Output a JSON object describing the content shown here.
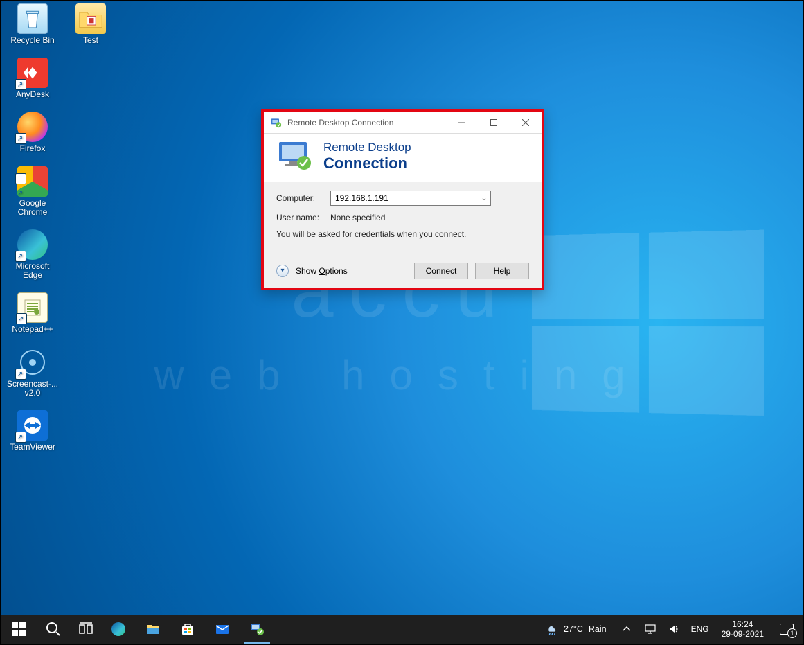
{
  "desktop_icons_col1": [
    {
      "id": "recycle-bin",
      "label": "Recycle Bin",
      "shortcut": false,
      "glyph": "recycle-bin"
    },
    {
      "id": "anydesk",
      "label": "AnyDesk",
      "shortcut": true,
      "glyph": "anydesk"
    },
    {
      "id": "firefox",
      "label": "Firefox",
      "shortcut": true,
      "glyph": "firefox"
    },
    {
      "id": "chrome",
      "label": "Google Chrome",
      "shortcut": true,
      "glyph": "chrome"
    },
    {
      "id": "edge",
      "label": "Microsoft Edge",
      "shortcut": true,
      "glyph": "edge"
    },
    {
      "id": "notepadpp",
      "label": "Notepad++",
      "shortcut": true,
      "glyph": "notepadpp"
    },
    {
      "id": "screencast",
      "label": "Screencast-... v2.0",
      "shortcut": true,
      "glyph": "screencast"
    },
    {
      "id": "teamviewer",
      "label": "TeamViewer",
      "shortcut": true,
      "glyph": "teamviewer"
    }
  ],
  "desktop_icons_col2": [
    {
      "id": "test-folder",
      "label": "Test",
      "shortcut": false,
      "glyph": "folder"
    }
  ],
  "watermark": {
    "line1": "accu",
    "line2": "web hosting"
  },
  "rdc": {
    "title": "Remote Desktop Connection",
    "banner_line1": "Remote Desktop",
    "banner_line2": "Connection",
    "computer_label": "Computer:",
    "computer_value": "192.168.1.191",
    "username_label": "User name:",
    "username_value": "None specified",
    "hint": "You will be asked for credentials when you connect.",
    "show_options_prefix": "Show ",
    "show_options_underlined": "O",
    "show_options_suffix": "ptions",
    "connect": "Connect",
    "help": "Help"
  },
  "taskbar": {
    "weather_temp": "27°C",
    "weather_cond": "Rain",
    "lang": "ENG",
    "time": "16:24",
    "date": "29-09-2021",
    "notif_count": "1",
    "pinned": [
      {
        "id": "start",
        "name": "start-button"
      },
      {
        "id": "search",
        "name": "search-button"
      },
      {
        "id": "taskview",
        "name": "task-view-button"
      },
      {
        "id": "edge",
        "name": "taskbar-edge"
      },
      {
        "id": "explorer",
        "name": "taskbar-file-explorer"
      },
      {
        "id": "store",
        "name": "taskbar-ms-store"
      },
      {
        "id": "mail",
        "name": "taskbar-mail"
      },
      {
        "id": "rdc",
        "name": "taskbar-remote-desktop"
      }
    ]
  }
}
